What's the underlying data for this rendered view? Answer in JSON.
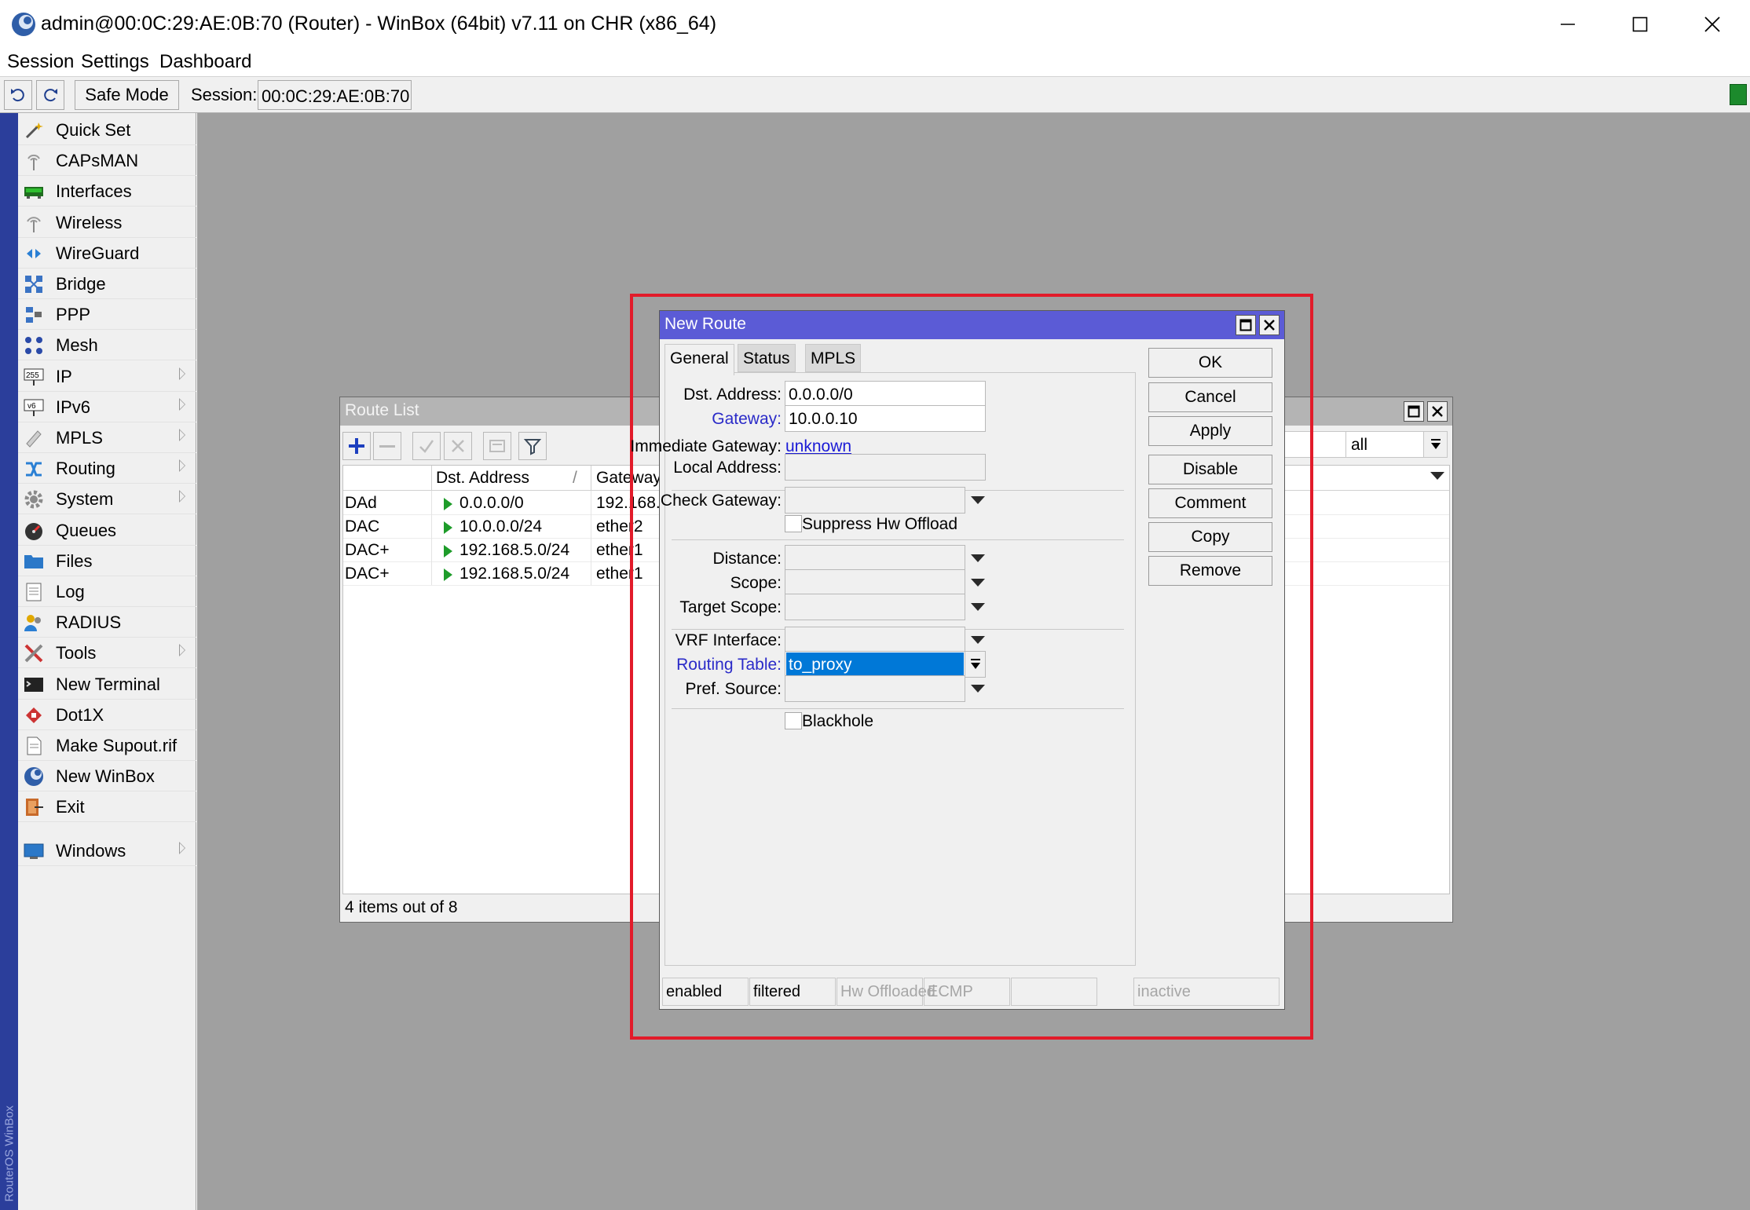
{
  "window": {
    "title": "admin@00:0C:29:AE:0B:70 (Router) - WinBox (64bit) v7.11 on CHR (x86_64)"
  },
  "menubar": {
    "items": [
      "Session",
      "Settings",
      "Dashboard"
    ]
  },
  "toolbar": {
    "safe_mode_label": "Safe Mode",
    "session_label": "Session:",
    "session_value": "00:0C:29:AE:0B:70",
    "status_color": "#1c8a2c"
  },
  "vertical_brand": "RouterOS WinBox",
  "sidebar": {
    "items": [
      {
        "label": "Quick Set",
        "icon": "wand-icon"
      },
      {
        "label": "CAPsMAN",
        "icon": "antenna-icon"
      },
      {
        "label": "Interfaces",
        "icon": "network-card-icon"
      },
      {
        "label": "Wireless",
        "icon": "wireless-icon"
      },
      {
        "label": "WireGuard",
        "icon": "wireguard-icon"
      },
      {
        "label": "Bridge",
        "icon": "bridge-icon"
      },
      {
        "label": "PPP",
        "icon": "ppp-icon"
      },
      {
        "label": "Mesh",
        "icon": "mesh-icon"
      },
      {
        "label": "IP",
        "icon": "ip-icon",
        "submenu": true
      },
      {
        "label": "IPv6",
        "icon": "ipv6-icon",
        "submenu": true
      },
      {
        "label": "MPLS",
        "icon": "mpls-icon",
        "submenu": true
      },
      {
        "label": "Routing",
        "icon": "routing-icon",
        "submenu": true
      },
      {
        "label": "System",
        "icon": "gear-icon",
        "submenu": true
      },
      {
        "label": "Queues",
        "icon": "gauge-icon"
      },
      {
        "label": "Files",
        "icon": "folder-icon"
      },
      {
        "label": "Log",
        "icon": "notepad-icon"
      },
      {
        "label": "RADIUS",
        "icon": "users-icon"
      },
      {
        "label": "Tools",
        "icon": "tools-icon",
        "submenu": true
      },
      {
        "label": "New Terminal",
        "icon": "terminal-icon"
      },
      {
        "label": "Dot1X",
        "icon": "dot1x-icon"
      },
      {
        "label": "Make Supout.rif",
        "icon": "document-icon"
      },
      {
        "label": "New WinBox",
        "icon": "winbox-icon"
      },
      {
        "label": "Exit",
        "icon": "exit-icon"
      },
      {
        "label": "Windows",
        "icon": "monitor-icon",
        "submenu": true
      }
    ]
  },
  "route_list": {
    "title": "Route List",
    "filter_value": "all",
    "columns": [
      "Dst. Address",
      "Gateway"
    ],
    "rows": [
      {
        "flags": "DAd",
        "dst": "0.0.0.0/0",
        "gateway": "192.168."
      },
      {
        "flags": "DAC",
        "dst": "10.0.0.0/24",
        "gateway": "ether2"
      },
      {
        "flags": "DAC+",
        "dst": "192.168.5.0/24",
        "gateway": "ether1"
      },
      {
        "flags": "DAC+",
        "dst": "192.168.5.0/24",
        "gateway": "ether1"
      }
    ],
    "footer": "4 items out of 8"
  },
  "new_route": {
    "title": "New Route",
    "tabs": [
      "General",
      "Status",
      "MPLS"
    ],
    "fields": {
      "dst_address": {
        "label": "Dst. Address:",
        "value": "0.0.0.0/0"
      },
      "gateway": {
        "label": "Gateway:",
        "value": "10.0.0.10"
      },
      "immediate_gateway": {
        "label": "Immediate Gateway:",
        "value": "unknown"
      },
      "local_address": {
        "label": "Local Address:",
        "value": ""
      },
      "check_gateway": {
        "label": "Check Gateway:",
        "value": ""
      },
      "suppress_hw_offload": {
        "label": "Suppress Hw Offload",
        "checked": false
      },
      "distance": {
        "label": "Distance:",
        "value": ""
      },
      "scope": {
        "label": "Scope:",
        "value": ""
      },
      "target_scope": {
        "label": "Target Scope:",
        "value": ""
      },
      "vrf_interface": {
        "label": "VRF Interface:",
        "value": ""
      },
      "routing_table": {
        "label": "Routing Table:",
        "value": "to_proxy"
      },
      "pref_source": {
        "label": "Pref. Source:",
        "value": ""
      },
      "blackhole": {
        "label": "Blackhole",
        "checked": false
      }
    },
    "buttons": [
      "OK",
      "Cancel",
      "Apply",
      "Disable",
      "Comment",
      "Copy",
      "Remove"
    ],
    "status_bar": [
      "enabled",
      "filtered",
      "Hw Offloaded",
      "ECMP",
      "inactive"
    ],
    "highlight_color": "#e21b2a",
    "title_color": "#5b5bd6",
    "selection_color": "#0078d7"
  }
}
